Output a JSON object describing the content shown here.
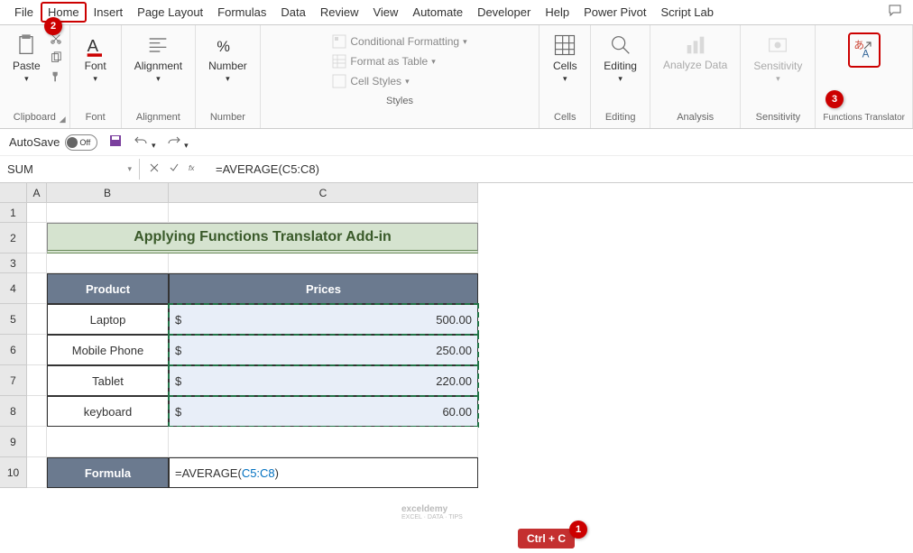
{
  "tabs": [
    "File",
    "Home",
    "Insert",
    "Page Layout",
    "Formulas",
    "Data",
    "Review",
    "View",
    "Automate",
    "Developer",
    "Help",
    "Power Pivot",
    "Script Lab"
  ],
  "active_tab_index": 1,
  "ribbon": {
    "clipboard": {
      "label": "Clipboard",
      "paste": "Paste"
    },
    "font": {
      "label": "Font",
      "btn": "Font"
    },
    "alignment": {
      "label": "Alignment",
      "btn": "Alignment"
    },
    "number": {
      "label": "Number",
      "btn": "Number"
    },
    "styles": {
      "label": "Styles",
      "cf": "Conditional Formatting",
      "fat": "Format as Table",
      "cs": "Cell Styles"
    },
    "cells": {
      "label": "Cells",
      "btn": "Cells"
    },
    "editing": {
      "label": "Editing",
      "btn": "Editing"
    },
    "analysis": {
      "label": "Analysis",
      "btn": "Analyze Data"
    },
    "sensitivity": {
      "label": "Sensitivity",
      "btn": "Sensitivity"
    },
    "ft": {
      "label": "Functions Translator"
    }
  },
  "qat": {
    "autosave": "AutoSave",
    "off": "Off"
  },
  "namebox": "SUM",
  "formula_bar": "=AVERAGE(C5:C8)",
  "columns": [
    "A",
    "B",
    "C"
  ],
  "rows": [
    "1",
    "2",
    "3",
    "4",
    "5",
    "6",
    "7",
    "8",
    "9",
    "10"
  ],
  "sheet": {
    "title": "Applying Functions Translator Add-in",
    "h_product": "Product",
    "h_prices": "Prices",
    "products": [
      "Laptop",
      "Mobile Phone",
      "Tablet",
      "keyboard"
    ],
    "currency": "$",
    "prices": [
      "500.00",
      "250.00",
      "220.00",
      "60.00"
    ],
    "formula_label": "Formula",
    "formula_prefix": "=AVERAGE(",
    "formula_ref": "C5:C8",
    "formula_suffix": ")"
  },
  "callouts": {
    "c1": "1",
    "c2": "2",
    "c3": "3",
    "ctrlc": "Ctrl + C"
  },
  "watermark": {
    "brand": "exceldemy",
    "tag": "EXCEL · DATA · TIPS"
  }
}
